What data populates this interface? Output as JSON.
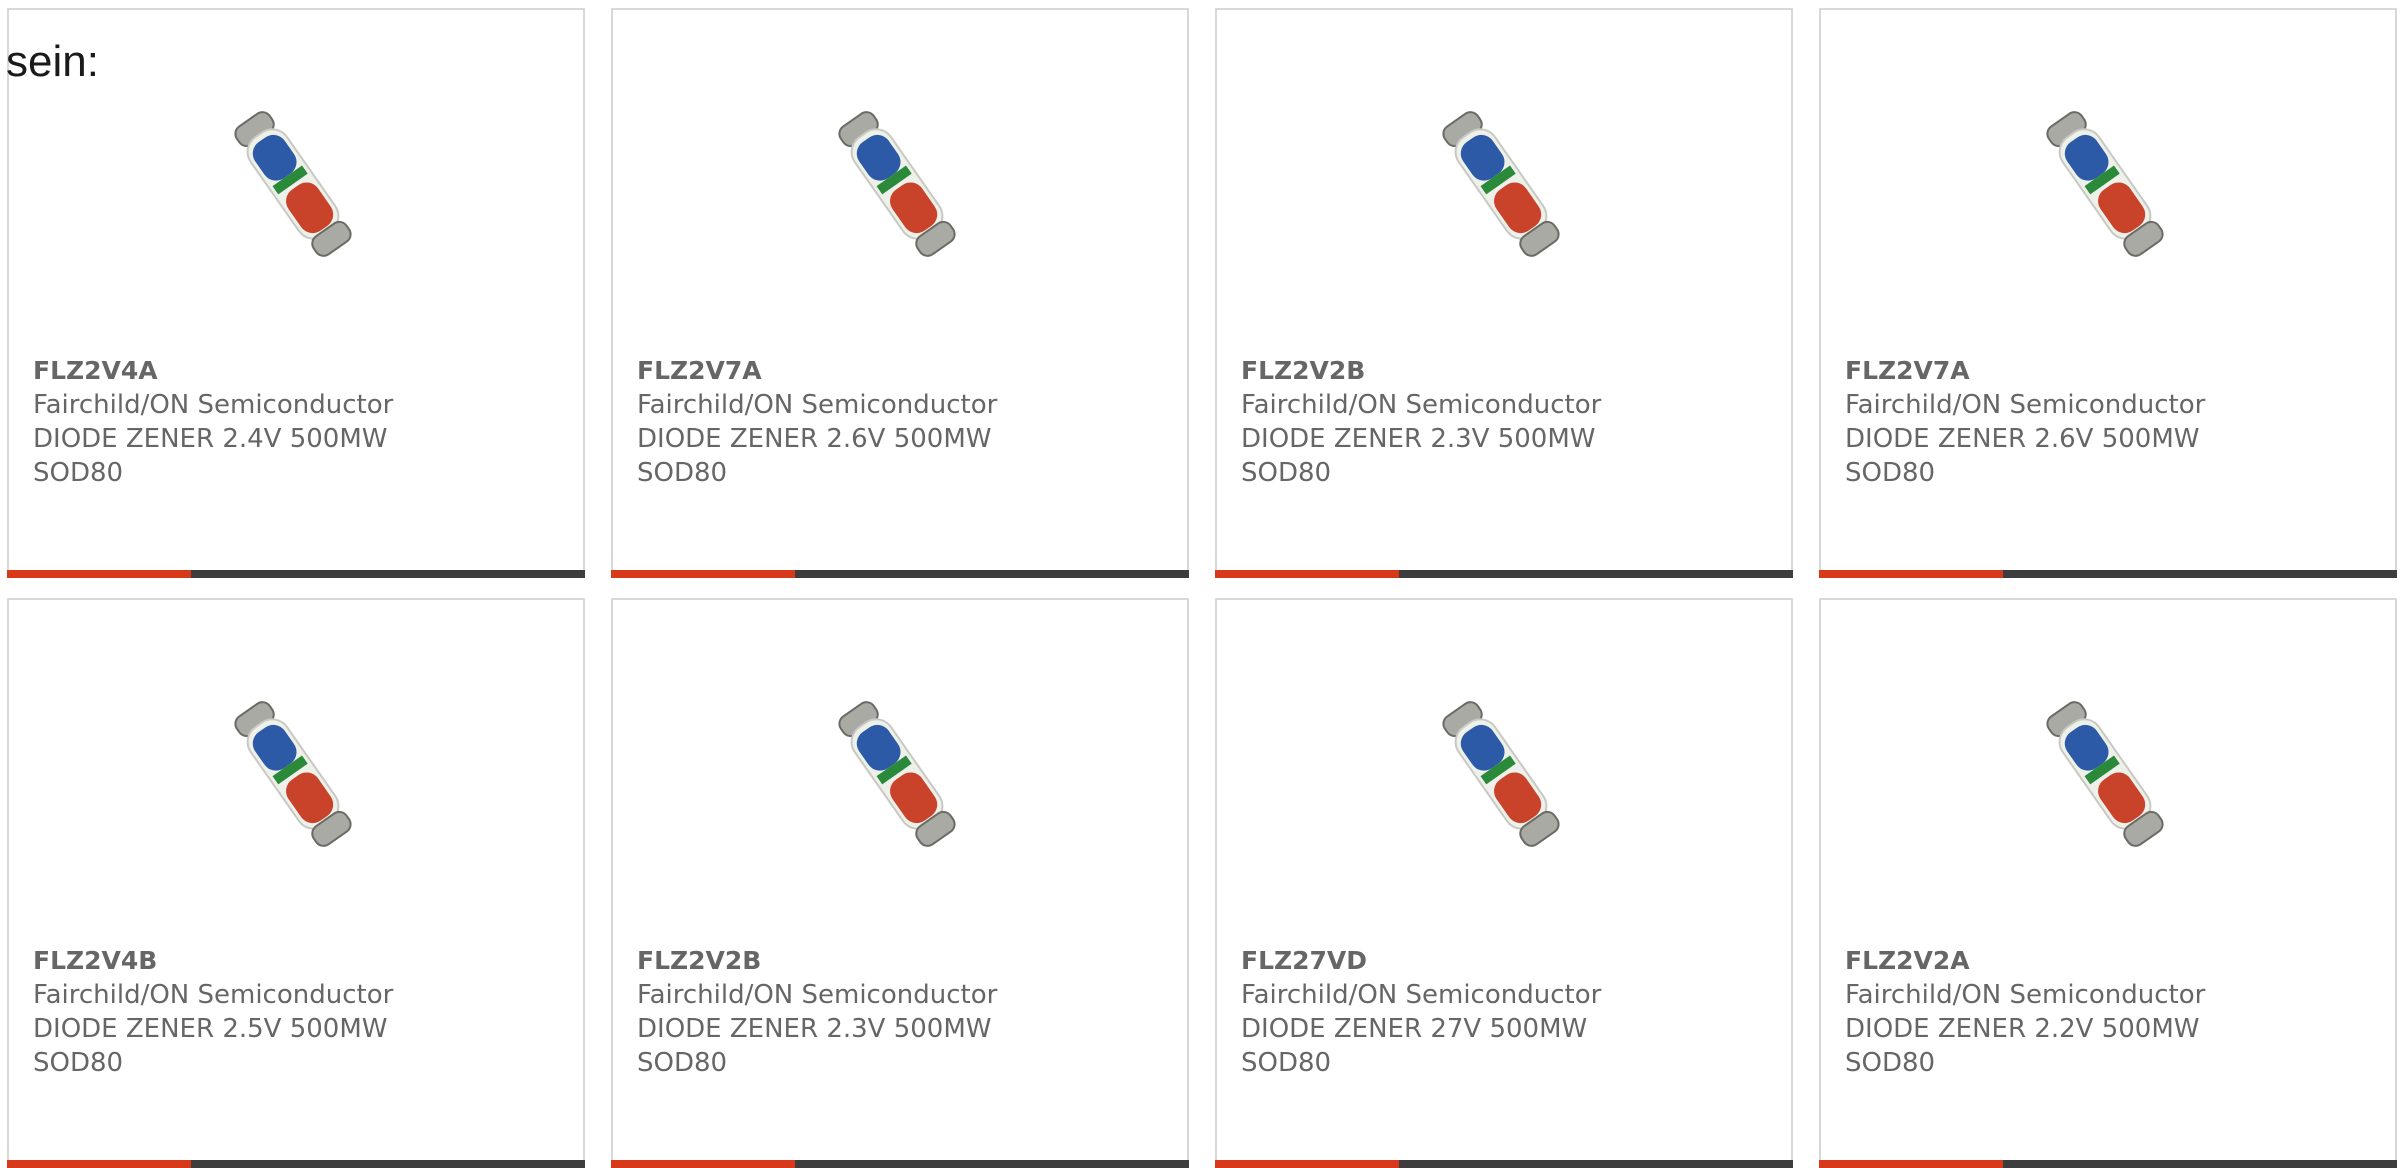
{
  "page": {
    "fragment_text": "sein:"
  },
  "accent_color": "#d9391b",
  "bar_color": "#3d3d3d",
  "products": [
    {
      "part_number": "FLZ2V4A",
      "manufacturer": "Fairchild/ON Semiconductor",
      "description": "DIODE ZENER 2.4V 500MW",
      "package": "SOD80",
      "image_icon": "zener-diode-image"
    },
    {
      "part_number": "FLZ2V7A",
      "manufacturer": "Fairchild/ON Semiconductor",
      "description": "DIODE ZENER 2.6V 500MW",
      "package": "SOD80",
      "image_icon": "zener-diode-image"
    },
    {
      "part_number": "FLZ2V2B",
      "manufacturer": "Fairchild/ON Semiconductor",
      "description": "DIODE ZENER 2.3V 500MW",
      "package": "SOD80",
      "image_icon": "zener-diode-image"
    },
    {
      "part_number": "FLZ2V7A",
      "manufacturer": "Fairchild/ON Semiconductor",
      "description": "DIODE ZENER 2.6V 500MW",
      "package": "SOD80",
      "image_icon": "zener-diode-image"
    },
    {
      "part_number": "FLZ2V4B",
      "manufacturer": "Fairchild/ON Semiconductor",
      "description": "DIODE ZENER 2.5V 500MW",
      "package": "SOD80",
      "image_icon": "zener-diode-image"
    },
    {
      "part_number": "FLZ2V2B",
      "manufacturer": "Fairchild/ON Semiconductor",
      "description": "DIODE ZENER 2.3V 500MW",
      "package": "SOD80",
      "image_icon": "zener-diode-image"
    },
    {
      "part_number": "FLZ27VD",
      "manufacturer": "Fairchild/ON Semiconductor",
      "description": "DIODE ZENER 27V 500MW",
      "package": "SOD80",
      "image_icon": "zener-diode-image"
    },
    {
      "part_number": "FLZ2V2A",
      "manufacturer": "Fairchild/ON Semiconductor",
      "description": "DIODE ZENER 2.2V 500MW",
      "package": "SOD80",
      "image_icon": "zener-diode-image"
    }
  ]
}
